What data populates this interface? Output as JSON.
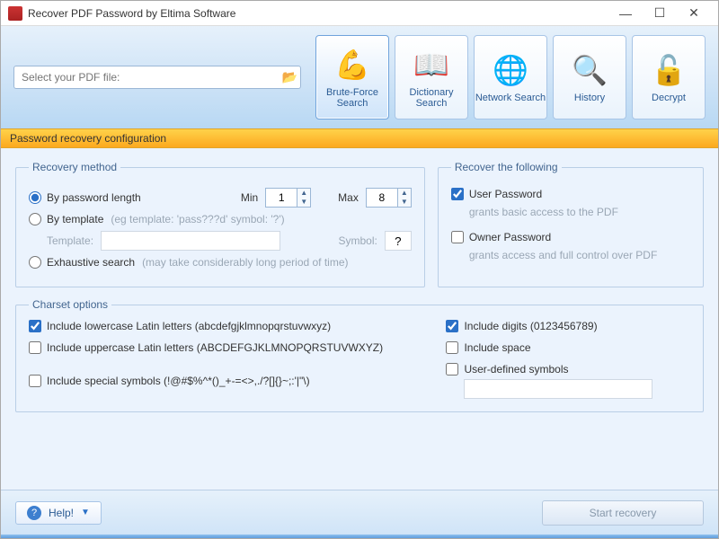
{
  "window": {
    "title": "Recover PDF Password by Eltima Software"
  },
  "file": {
    "placeholder": "Select your PDF file:",
    "browse_icon": "folder-open-icon"
  },
  "toolbar": [
    {
      "key": "brute",
      "label": "Brute-Force Search",
      "icon": "💪"
    },
    {
      "key": "dict",
      "label": "Dictionary Search",
      "icon": "📖"
    },
    {
      "key": "net",
      "label": "Network Search",
      "icon": "🌐"
    },
    {
      "key": "hist",
      "label": "History",
      "icon": "🔍"
    },
    {
      "key": "decrypt",
      "label": "Decrypt",
      "icon": "🔓"
    }
  ],
  "active_tool": "brute",
  "section_label": "Password recovery configuration",
  "recovery": {
    "legend": "Recovery method",
    "by_length": "By password length",
    "min_label": "Min",
    "min_value": "1",
    "max_label": "Max",
    "max_value": "8",
    "by_template": "By template",
    "template_hint": "(eg template: 'pass???d' symbol: '?')",
    "template_label": "Template:",
    "symbol_label": "Symbol:",
    "symbol_value": "?",
    "exhaustive": "Exhaustive search",
    "exhaustive_hint": "(may take considerably long period of time)"
  },
  "recover_following": {
    "legend": "Recover the following",
    "user_pw": "User Password",
    "user_desc": "grants basic access to the PDF",
    "owner_pw": "Owner Password",
    "owner_desc": "grants access and full control over PDF"
  },
  "charset": {
    "legend": "Charset options",
    "lowercase": "Include lowercase Latin letters (abcdefgjklmnopqrstuvwxyz)",
    "uppercase": "Include uppercase Latin letters (ABCDEFGJKLMNOPQRSTUVWXYZ)",
    "special": "Include special symbols (!@#$%^*()_+-=<>,./?[]{}~;:'|\"\\)",
    "digits": "Include digits (0123456789)",
    "space": "Include space",
    "userdef": "User-defined symbols"
  },
  "footer": {
    "help": "Help!",
    "start": "Start recovery"
  }
}
